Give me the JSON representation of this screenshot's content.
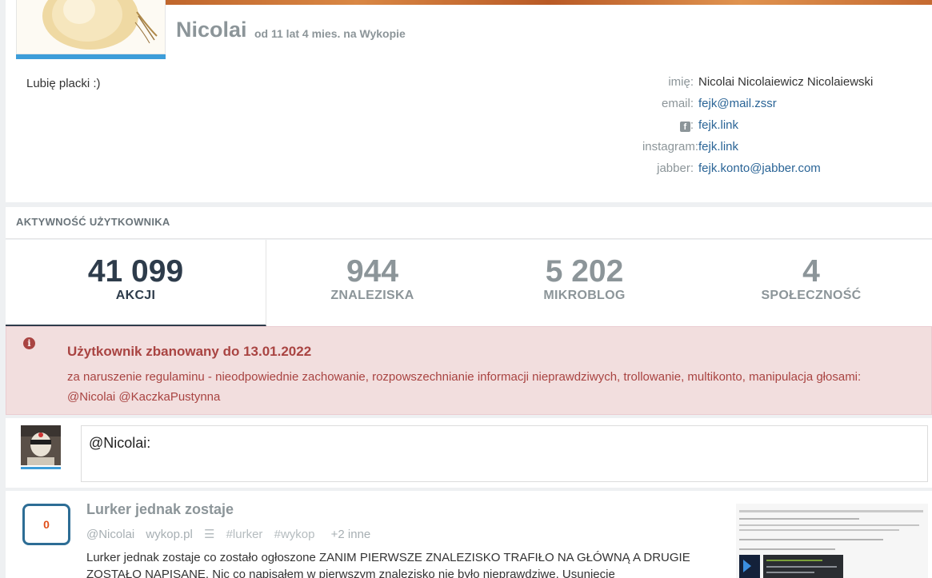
{
  "profile": {
    "username": "Nicolai",
    "member_since": "od 11 lat 4 mies. na Wykopie",
    "bio": "Lubię placki :)",
    "info": [
      {
        "label": "imię:",
        "value": "Nicolai Nicolaiewicz Nicolaiewski",
        "link": false
      },
      {
        "label": "email:",
        "value": "fejk@mail.zssr",
        "link": true
      },
      {
        "label": ":",
        "value": "fejk.link",
        "link": true,
        "icon": "facebook-icon"
      },
      {
        "label": "instagram:",
        "value": "fejk.link",
        "link": true
      },
      {
        "label": "jabber:",
        "value": "fejk.konto@jabber.com",
        "link": true
      }
    ]
  },
  "activity": {
    "title": "AKTYWNOŚĆ UŻYTKOWNIKA",
    "stats": [
      {
        "number": "41 099",
        "label": "AKCJI",
        "active": true
      },
      {
        "number": "944",
        "label": "ZNALEZISKA",
        "active": false
      },
      {
        "number": "5 202",
        "label": "MIKROBLOG",
        "active": false
      },
      {
        "number": "4",
        "label": "SPOŁECZNOŚĆ",
        "active": false
      }
    ]
  },
  "ban": {
    "icon": "info-icon",
    "title": "Użytkownik zbanowany do 13.01.2022",
    "text": "za naruszenie regulaminu - nieodpowiednie zachowanie, rozpowszechnianie informacji nieprawdziwych, trollowanie, multikonto, manipulacja głosami: @Nicolai @KaczkaPustynna"
  },
  "comment": {
    "value": "@Nicolai:"
  },
  "link": {
    "votes": "0",
    "title": "Lurker jednak zostaje",
    "author": "@Nicolai",
    "domain": "wykop.pl",
    "tags": [
      "#lurker",
      "#wykop"
    ],
    "more_tags": "+2 inne",
    "description": "Lurker jednak zostaje co zostało ogłoszone ZANIM PIERWSZE ZNALEZISKO TRAFIŁO NA GŁÓWNĄ A DRUGIE ZOSTAŁO NAPISANE. Nic co napisałem w pierwszym znalezisko nie było nieprawdziwe. Usunięcie"
  },
  "colors": {
    "accent": "#3d9dd9",
    "ban_text": "#a94442",
    "ban_bg": "#f2dede",
    "muted": "#8c9599",
    "active_stat": "#2e3c4b",
    "link": "#2a6496"
  }
}
